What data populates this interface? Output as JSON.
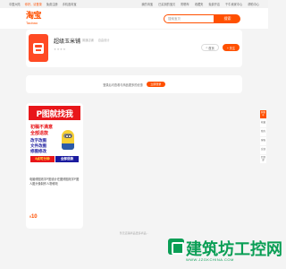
{
  "topbar": {
    "left": [
      "中国大陆",
      "你好，请登录",
      "免费注册",
      "手机逛淘宝"
    ],
    "right": [
      "我的淘宝",
      "已买到的宝贝",
      "购物车",
      "收藏夹",
      "免费开店",
      "千牛卖家中心",
      "帮助中心"
    ]
  },
  "header": {
    "logo_cn": "淘宝",
    "logo_en": "Taobao",
    "search_placeholder": "搜索宝贝",
    "search_button": "搜索"
  },
  "shop": {
    "name": "超级玉米铺",
    "meta": [
      "普通店铺",
      "自由设计"
    ],
    "stars": "★★★★",
    "home_button": "首页",
    "follow_button": "+ 关注"
  },
  "notice": {
    "text": "登录后可查看与商品更多的优惠",
    "button": "立即登录"
  },
  "product": {
    "image_title": "P图就找我",
    "image_line1": "初稿不满意",
    "image_line2": "全部退款",
    "image_line3": "改字改图",
    "image_line4": "文件改图",
    "image_line5": "修图修改",
    "image_badge1": "8点可分钟",
    "image_badge2": "全部退款",
    "description": "电脑修图改字P图设计在图修图改字P图人图头像制作人物修改",
    "price_symbol": "¥",
    "price": "10"
  },
  "footer": {
    "more": "暂无店铺商品更多商品..."
  },
  "sidebar": {
    "items": [
      "购物车",
      "收藏",
      "我的",
      "客服",
      "反馈",
      "回顶部"
    ]
  },
  "watermark": {
    "text": "建筑坊工控网",
    "sub": "WWW.JZGKCHINA.COM"
  },
  "colors": {
    "brand": "#ff5000",
    "watermark": "#0a9e55"
  }
}
